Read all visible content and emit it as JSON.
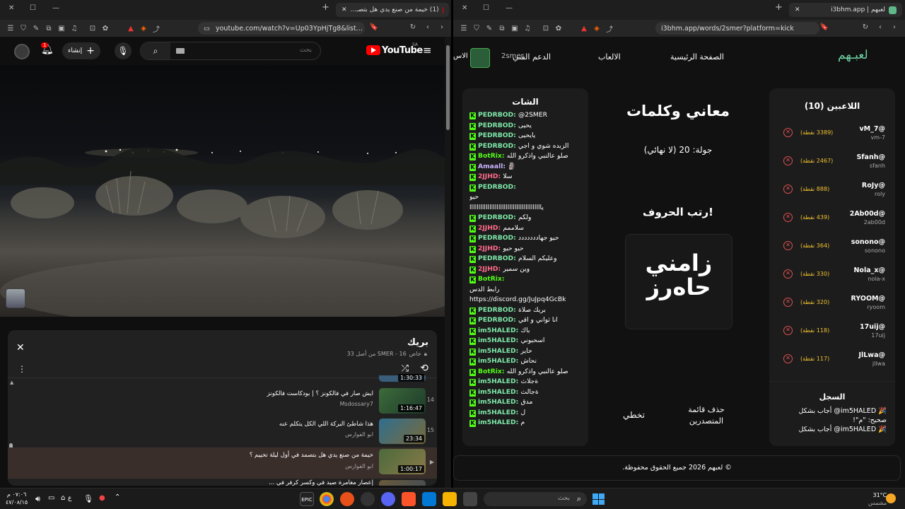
{
  "left": {
    "tab_title": "(1) خيمة من صنع يدي هل بتصـ...",
    "tab_new": "+",
    "url": "youtube.com/watch?v=Up03YpHjTg8&list...",
    "yt": {
      "logo": "YouTube",
      "region": "SA",
      "search_placeholder": "بحث",
      "create_label": "إنشاء",
      "notif_count": "1"
    },
    "playlist": {
      "title": "بريك",
      "meta": "SMER - 16 من أصل 33",
      "owner_prefix": "خاص",
      "items": [
        {
          "index": "14",
          "title": "ايش صار في فالكونز ؟ | بودكاست فالكونز",
          "channel": "Msdossary7",
          "duration": "1:16:47",
          "thumb_color": "#3d6b3a"
        },
        {
          "index": "15",
          "title": "هذا شاطئ البركة اللي الكل يتكلم عنه",
          "channel": "ابو الفوارس",
          "duration": "23:34",
          "thumb_color": "#2f6f8f"
        },
        {
          "index": "",
          "title": "خيمة من صنع يدي هل بتصمد في أول ليلة تخييم ؟",
          "channel": "ابو الفوارس",
          "duration": "1:00:17",
          "thumb_color": "#4c6a3b",
          "current": true
        },
        {
          "index": "",
          "title": "إعصار مغامرة صيد في وكسر كرفر في ...",
          "channel": "",
          "duration": "",
          "thumb_color": "#6a5a3b"
        }
      ],
      "prev_duration": "1:30:33"
    }
  },
  "right": {
    "tab_title": "لعبهم | i3bhm.app",
    "url": "i3bhm.app/words/2smer?platform=kick",
    "nav": {
      "logo": "لعبـهم",
      "home": "الصفحة الرئيسية",
      "games": "الالعاب",
      "support": "الدعم الفني",
      "user": "2smer",
      "more": "الاس"
    },
    "players": {
      "title": "اللاعبين (10)",
      "list": [
        {
          "name": "@vM_7",
          "handle": "vm-7",
          "points": "(3389 نقطة)"
        },
        {
          "name": "@Sfanh",
          "handle": "sfanh",
          "points": "(2467 نقطة)"
        },
        {
          "name": "@RoJy",
          "handle": "roly",
          "points": "(888 نقطة)"
        },
        {
          "name": "@2Ab00d",
          "handle": "2ab00d",
          "points": "(439 نقطة)"
        },
        {
          "name": "@sonono",
          "handle": "sonono",
          "points": "(364 نقطة)"
        },
        {
          "name": "@Nola_x",
          "handle": "nola-x",
          "points": "(330 نقطة)"
        },
        {
          "name": "@RYOOM",
          "handle": "ryoom",
          "points": "(320 نقطة)"
        },
        {
          "name": "@17uij",
          "handle": "17uij",
          "points": "(118 نقطة)"
        },
        {
          "name": "@JlLwa",
          "handle": "jllwa",
          "points": "(117 نقطة)"
        }
      ],
      "log_title": "السجل",
      "log_lines": [
        "🎉 im5HALED@ أجاب بشكل",
        "صحيح: \"م\"!",
        "🎉 im5HALED@ أجاب بشكل"
      ]
    },
    "game": {
      "title": "معاني وكلمات",
      "round": "جولة: 20 (لا نهائي)",
      "arrange": "رتب الحروف!",
      "word_line1": "زامني",
      "word_line2": "حاەرز",
      "skip": "تخطي",
      "clear_leaders": "حذف قائمة المتصدرين"
    },
    "chat": {
      "title": "الشات",
      "lines": [
        {
          "user": "PEDRBOD",
          "color": "#7ee8a8",
          "msg": "@2SMER"
        },
        {
          "user": "PEDRBOD",
          "color": "#7ee8a8",
          "msg": "يحيى"
        },
        {
          "user": "PEDRBOD",
          "color": "#7ee8a8",
          "msg": "يايحيى"
        },
        {
          "user": "PEDRBOD",
          "color": "#7ee8a8",
          "msg": "الزبده شوي و اجي"
        },
        {
          "user": "BotRix",
          "color": "#53fc18",
          "msg": "صلو عالنبي واذكرو الله"
        },
        {
          "user": "Amaall",
          "color": "#c9b3ff",
          "msg": "🗿"
        },
        {
          "user": "2JJHD",
          "color": "#ff6b8b",
          "msg": "سلا"
        },
        {
          "user": "PEDRBOD",
          "color": "#7ee8a8",
          "msg": ""
        },
        {
          "user": "",
          "color": "#fff",
          "msg": "حيو"
        },
        {
          "user": "",
          "color": "#fff",
          "msg": "ياااااااااااااااااااااااااااااااااااااااا"
        },
        {
          "user": "PEDRBOD",
          "color": "#7ee8a8",
          "msg": "ولكم"
        },
        {
          "user": "2JJHD",
          "color": "#ff6b8b",
          "msg": "سلاممم"
        },
        {
          "user": "PEDRBOD",
          "color": "#7ee8a8",
          "msg": "حيو جهاددددددد"
        },
        {
          "user": "2JJHD",
          "color": "#ff6b8b",
          "msg": "حيو حيو"
        },
        {
          "user": "PEDRBOD",
          "color": "#7ee8a8",
          "msg": "وعليكم السلام"
        },
        {
          "user": "2JJHD",
          "color": "#ff6b8b",
          "msg": "وين سمير"
        },
        {
          "user": "BotRix",
          "color": "#53fc18",
          "msg": ""
        },
        {
          "user": "",
          "color": "#fff",
          "msg": "رابط الدس"
        },
        {
          "user": "",
          "color": "#fff",
          "msg": "https://discord.gg/JuJpq4GcBk"
        },
        {
          "user": "PEDRBOD",
          "color": "#7ee8a8",
          "msg": "بريك صلاة"
        },
        {
          "user": "PEDRBOD",
          "color": "#7ee8a8",
          "msg": "انا ثواني و اقي"
        },
        {
          "user": "im5HALED",
          "color": "#7ee8a8",
          "msg": "باك"
        },
        {
          "user": "im5HALED",
          "color": "#7ee8a8",
          "msg": "اسحبوني"
        },
        {
          "user": "im5HALED",
          "color": "#7ee8a8",
          "msg": "حاير"
        },
        {
          "user": "im5HALED",
          "color": "#7ee8a8",
          "msg": "نحاش"
        },
        {
          "user": "BotRix",
          "color": "#53fc18",
          "msg": "صلو عالنبي واذكرو الله"
        },
        {
          "user": "im5HALED",
          "color": "#7ee8a8",
          "msg": "ةجلاث"
        },
        {
          "user": "im5HALED",
          "color": "#7ee8a8",
          "msg": "ةجالث"
        },
        {
          "user": "im5HALED",
          "color": "#7ee8a8",
          "msg": "مدق"
        },
        {
          "user": "im5HALED",
          "color": "#7ee8a8",
          "msg": "ل"
        },
        {
          "user": "im5HALED",
          "color": "#7ee8a8",
          "msg": "م"
        }
      ]
    },
    "footer": "© لعبهم 2026 جميع الحقوق محفوظة."
  },
  "taskbar": {
    "time": "٠٧:٠٦ م",
    "date": "٤٧/٠٨/١٥",
    "weather_temp": "31°C",
    "weather_desc": "مشمس",
    "search_placeholder": "بحث",
    "lang": "ع"
  }
}
